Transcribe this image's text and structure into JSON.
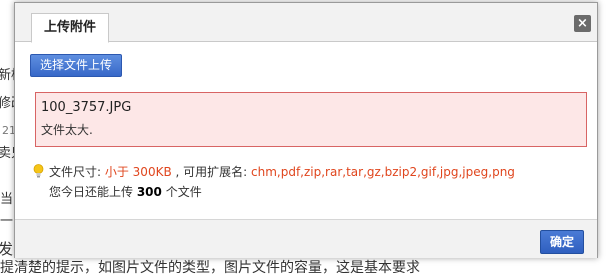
{
  "background": {
    "fragments": [
      "新桩",
      "修改",
      "21",
      "卖只",
      "当",
      "一",
      "发",
      "提清楚的提示，如图片文件的类型，图片文件的容量，这是基本要求"
    ]
  },
  "dialog": {
    "tab_label": "上传附件",
    "close_label": "×",
    "upload_button_label": "选择文件上传",
    "error": {
      "filename": "100_3757.JPG",
      "message": "文件太大."
    },
    "info": {
      "size_label": "文件尺寸: ",
      "size_value": "小于 300KB",
      "ext_label": " , 可用扩展名: ",
      "ext_value": "chm,pdf,zip,rar,tar,gz,bzip2,gif,jpg,jpeg,png",
      "today_prefix": "您今日还能上传 ",
      "today_count": "300",
      "today_suffix": " 个文件"
    },
    "ok_button_label": "确定"
  }
}
